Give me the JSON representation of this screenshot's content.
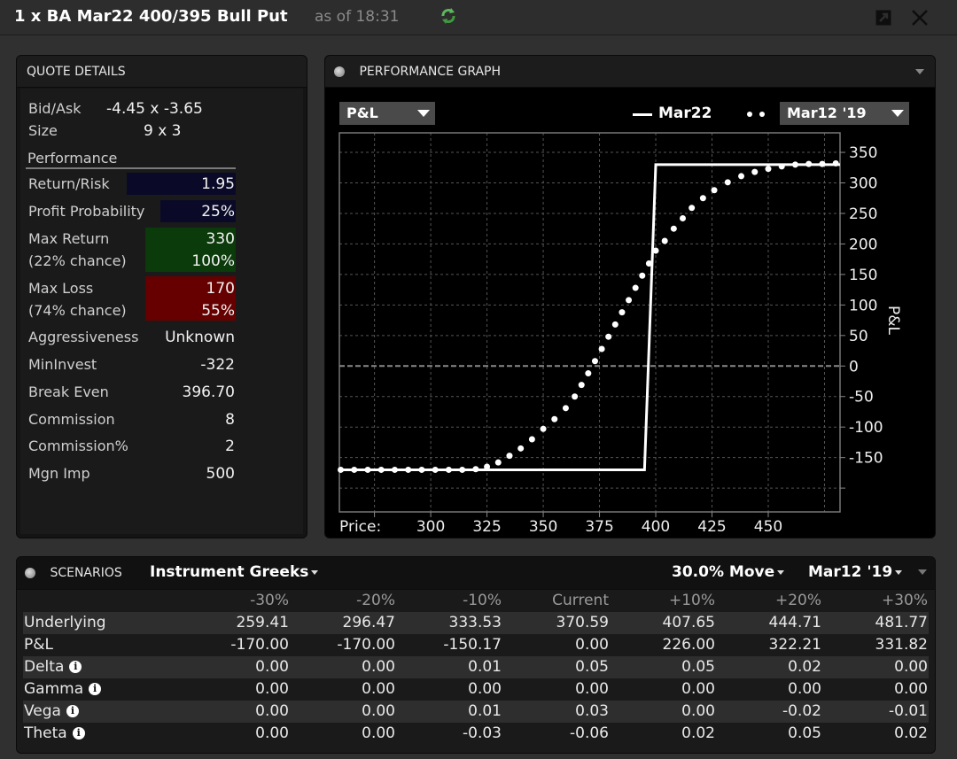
{
  "window": {
    "title": "1 x BA Mar22 400/395 Bull Put",
    "as_of": "as of 18:31",
    "icons": [
      "refresh-icon",
      "popout-icon",
      "close-icon"
    ]
  },
  "quote_details": {
    "header": "QUOTE DETAILS",
    "bid_ask_label": "Bid/Ask",
    "bid_ask_value": "-4.45 x -3.65",
    "size_label": "Size",
    "size_value": "9 x 3",
    "performance_label": "Performance",
    "return_risk_label": "Return/Risk",
    "return_risk_value": "1.95",
    "profit_prob_label": "Profit Probability",
    "profit_prob_value": "25%",
    "max_return_label": "Max Return",
    "max_return_chance": "(22% chance)",
    "max_return_value": "330",
    "max_return_pct": "100%",
    "max_loss_label": "Max Loss",
    "max_loss_chance": "(74% chance)",
    "max_loss_value": "170",
    "max_loss_pct": "55%",
    "rows": [
      {
        "label": "Aggressiveness",
        "value": "Unknown"
      },
      {
        "label": "MinInvest",
        "value": "-322"
      },
      {
        "label": "Break Even",
        "value": "396.70"
      },
      {
        "label": "Commission",
        "value": "8"
      },
      {
        "label": "Commission%",
        "value": "2"
      },
      {
        "label": "Mgn Imp",
        "value": "500"
      }
    ],
    "colors": {
      "ratio_box": "#0a0a28",
      "return_box": "#0b3a0b",
      "loss_box": "#660000"
    }
  },
  "performance_graph": {
    "header": "PERFORMANCE GRAPH",
    "metric_dropdown": "P&L",
    "legend_solid": "Mar22",
    "date_dropdown": "Mar12 '19"
  },
  "chart_data": {
    "type": "line",
    "xlabel": "Price:",
    "ylabel": "P&L",
    "xlim": [
      259.4,
      481.9
    ],
    "ylim": [
      -239,
      382
    ],
    "x_ticks": [
      300,
      325,
      350,
      375,
      400,
      425,
      450
    ],
    "x_grid": [
      275,
      300,
      325,
      350,
      375,
      400,
      425,
      450,
      475
    ],
    "y_ticks": [
      350,
      300,
      250,
      200,
      150,
      100,
      50,
      0,
      -50,
      -100,
      -150
    ],
    "y_grid": [
      350,
      300,
      250,
      200,
      150,
      100,
      50,
      0,
      -50,
      -100,
      -150,
      -200
    ],
    "grid": true,
    "series": [
      {
        "name": "Mar22",
        "style": "solid",
        "x": [
          259.4,
          395,
          400,
          481.9
        ],
        "y": [
          -170,
          -170,
          330,
          330
        ]
      },
      {
        "name": "Mar12 '19",
        "style": "dotted",
        "x": [
          260,
          266,
          272,
          278,
          284,
          290,
          296,
          302,
          308,
          314,
          320,
          325,
          330,
          335,
          340,
          345,
          350,
          355,
          360,
          364,
          367,
          370,
          373,
          376,
          379,
          382,
          385,
          388,
          391,
          394,
          397,
          400,
          404,
          408,
          412,
          416,
          421,
          426,
          432,
          438,
          444,
          450,
          456,
          462,
          468,
          474,
          480
        ],
        "y": [
          -170,
          -170,
          -170,
          -170,
          -170,
          -170,
          -170,
          -170,
          -170,
          -170,
          -169,
          -165,
          -158,
          -147,
          -135,
          -120,
          -103,
          -87,
          -69,
          -50,
          -31,
          -12,
          8,
          28,
          48,
          68,
          88,
          108,
          128,
          148,
          168,
          189,
          205,
          225,
          242,
          259,
          275,
          288,
          301,
          311,
          318,
          323,
          327,
          330,
          331,
          331,
          332
        ]
      }
    ]
  },
  "scenarios": {
    "header": "SCENARIOS",
    "view_dropdown": "Instrument Greeks",
    "move_dropdown": "30.0% Move",
    "date_dropdown": "Mar12 '19",
    "columns": [
      "-30%",
      "-20%",
      "-10%",
      "Current",
      "+10%",
      "+20%",
      "+30%"
    ],
    "rows": [
      {
        "label": "Underlying",
        "info": false,
        "values": [
          "259.41",
          "296.47",
          "333.53",
          "370.59",
          "407.65",
          "444.71",
          "481.77"
        ]
      },
      {
        "label": "P&L",
        "info": false,
        "values": [
          "-170.00",
          "-170.00",
          "-150.17",
          "0.00",
          "226.00",
          "322.21",
          "331.82"
        ]
      },
      {
        "label": "Delta",
        "info": true,
        "values": [
          "0.00",
          "0.00",
          "0.01",
          "0.05",
          "0.05",
          "0.02",
          "0.00"
        ]
      },
      {
        "label": "Gamma",
        "info": true,
        "values": [
          "0.00",
          "0.00",
          "0.00",
          "0.00",
          "0.00",
          "0.00",
          "0.00"
        ]
      },
      {
        "label": "Vega",
        "info": true,
        "values": [
          "0.00",
          "0.00",
          "0.01",
          "0.03",
          "0.00",
          "-0.02",
          "-0.01"
        ]
      },
      {
        "label": "Theta",
        "info": true,
        "values": [
          "0.00",
          "0.00",
          "-0.03",
          "-0.06",
          "0.02",
          "0.05",
          "0.02"
        ]
      }
    ]
  }
}
